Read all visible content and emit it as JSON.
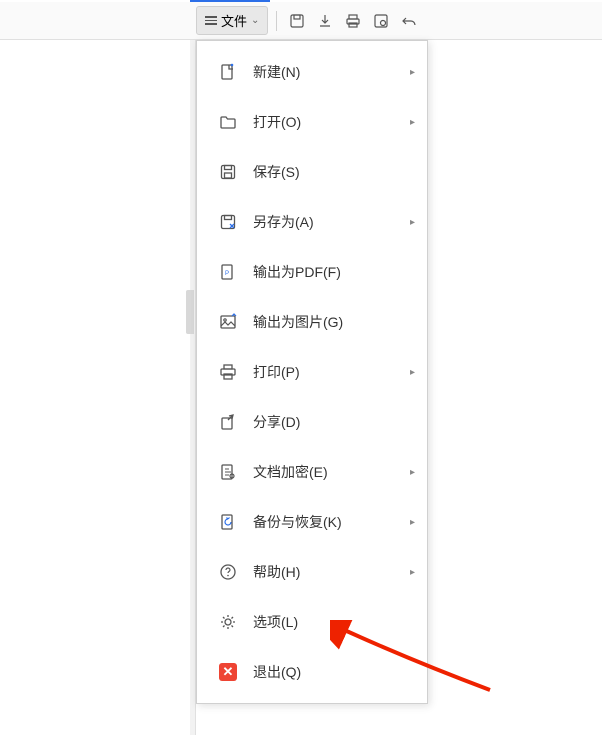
{
  "toolbar": {
    "file_label": "文件"
  },
  "menu": {
    "items": [
      {
        "label": "新建(N)",
        "icon": "new-file-icon",
        "submenu": true
      },
      {
        "label": "打开(O)",
        "icon": "open-folder-icon",
        "submenu": true
      },
      {
        "label": "保存(S)",
        "icon": "save-icon",
        "submenu": false
      },
      {
        "label": "另存为(A)",
        "icon": "save-as-icon",
        "submenu": true
      },
      {
        "label": "输出为PDF(F)",
        "icon": "export-pdf-icon",
        "submenu": false
      },
      {
        "label": "输出为图片(G)",
        "icon": "export-image-icon",
        "submenu": false
      },
      {
        "label": "打印(P)",
        "icon": "print-icon",
        "submenu": true
      },
      {
        "label": "分享(D)",
        "icon": "share-icon",
        "submenu": false
      },
      {
        "label": "文档加密(E)",
        "icon": "encrypt-icon",
        "submenu": true
      },
      {
        "label": "备份与恢复(K)",
        "icon": "backup-restore-icon",
        "submenu": true
      },
      {
        "label": "帮助(H)",
        "icon": "help-icon",
        "submenu": true
      },
      {
        "label": "选项(L)",
        "icon": "options-gear-icon",
        "submenu": false
      },
      {
        "label": "退出(Q)",
        "icon": "exit-icon",
        "submenu": false
      }
    ]
  }
}
